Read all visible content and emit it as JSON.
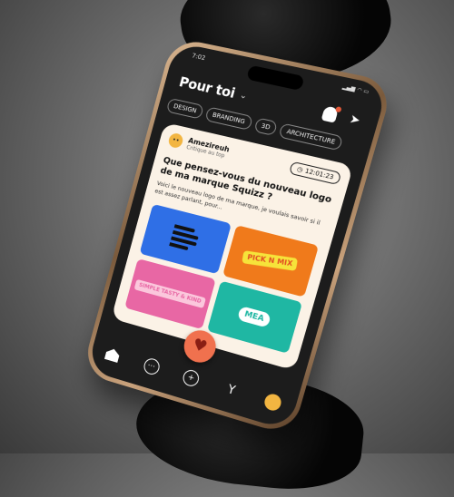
{
  "status": {
    "time": "7:02"
  },
  "header": {
    "title": "Pour toi"
  },
  "chips": [
    "DESIGN",
    "BRANDING",
    "3D",
    "ARCHITECTURE"
  ],
  "post": {
    "author": "Amezireuh",
    "role": "Critique au top",
    "timer": "12:01:23",
    "question": "Que pensez-vous du nouveau logo de ma marque Squizz ?",
    "description": "Voici le nouveau logo de ma marque, je voulais savoir si il est assez parlant, pour...",
    "tiles": [
      {
        "text": ""
      },
      {
        "text": "PICK N MIX"
      },
      {
        "text": "SIMPLE TASTY & KIND"
      },
      {
        "text": "MEA"
      }
    ]
  },
  "colors": {
    "accent": "#f0714e",
    "card": "#fbf2e6"
  },
  "icons": [
    "chevron-down-icon",
    "ghost-notification-icon",
    "send-icon",
    "home-icon",
    "more-icon",
    "add-icon",
    "trophy-icon",
    "profile-icon",
    "heart-icon",
    "clock-icon"
  ]
}
